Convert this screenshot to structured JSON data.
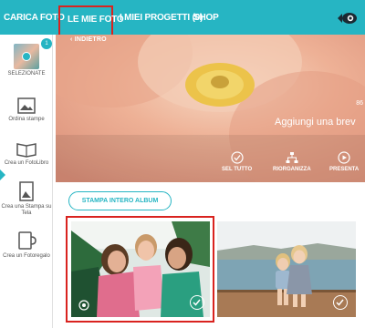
{
  "nav": {
    "items": [
      {
        "label": "CARICA FOTO"
      },
      {
        "label": "LE MIE FOTO"
      },
      {
        "label": "I MIEI PROGETTI (0)"
      },
      {
        "label": "SHOP"
      }
    ]
  },
  "sidebar": {
    "selected_count": "1",
    "items": [
      {
        "label": "SELEZIONATE"
      },
      {
        "label": "Ordina stampe"
      },
      {
        "label": "Crea un FotoLibro"
      },
      {
        "label": "Crea una Stampa su Tela"
      },
      {
        "label": "Crea un Fotoregalo"
      }
    ]
  },
  "hero": {
    "back_label": "INDIETRO",
    "number_partial": "86",
    "caption": "Aggiungi una brev",
    "actions": [
      {
        "label": "SEL TUTTO",
        "icon": "check-circle-icon"
      },
      {
        "label": "RIORGANIZZA",
        "icon": "sitemap-icon"
      },
      {
        "label": "PRESENTA",
        "icon": "play-circle-icon"
      }
    ]
  },
  "album_button": {
    "label": "STAMPA INTERO ALBUM"
  },
  "photos": [
    {
      "subject": "three-girls-photo",
      "selected": true
    },
    {
      "subject": "two-kids-on-dock-photo",
      "selected": true
    }
  ],
  "colors": {
    "accent": "#26b5c3",
    "highlight": "#d9231f"
  }
}
